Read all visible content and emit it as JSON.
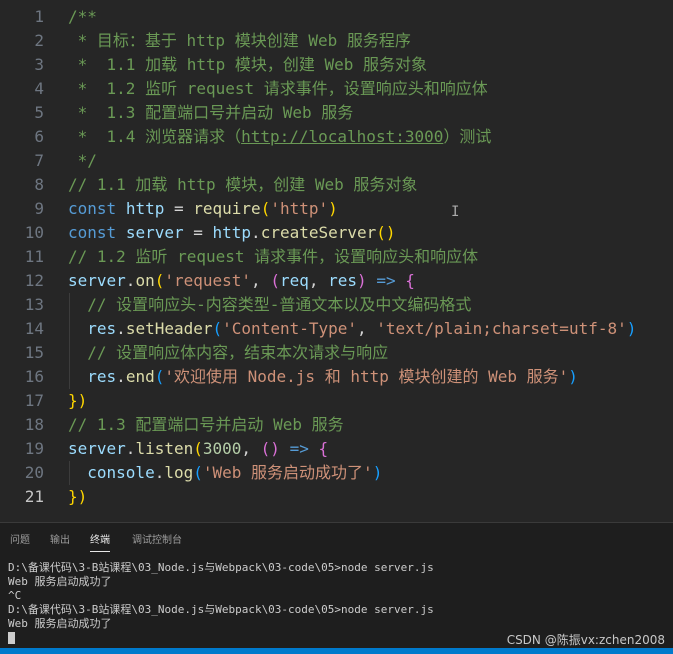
{
  "editor": {
    "lines": [
      {
        "n": "1",
        "tokens": [
          [
            "/**",
            "cm"
          ]
        ]
      },
      {
        "n": "2",
        "tokens": [
          [
            " * 目标：基于 http 模块创建 Web 服务程序",
            "cm"
          ]
        ]
      },
      {
        "n": "3",
        "tokens": [
          [
            " *  1.1 加载 http 模块，创建 Web 服务对象",
            "cm"
          ]
        ]
      },
      {
        "n": "4",
        "tokens": [
          [
            " *  1.2 监听 request 请求事件，设置响应头和响应体",
            "cm"
          ]
        ]
      },
      {
        "n": "5",
        "tokens": [
          [
            " *  1.3 配置端口号并启动 Web 服务",
            "cm"
          ]
        ]
      },
      {
        "n": "6",
        "tokens": [
          [
            " *  1.4 浏览器请求（",
            "cm"
          ],
          [
            "http://localhost:3000",
            "link"
          ],
          [
            "）测试",
            "cm"
          ]
        ]
      },
      {
        "n": "7",
        "tokens": [
          [
            " */",
            "cm"
          ]
        ]
      },
      {
        "n": "8",
        "tokens": [
          [
            "// 1.1 加载 http 模块，创建 Web 服务对象",
            "cm"
          ]
        ]
      },
      {
        "n": "9",
        "tokens": [
          [
            "const",
            "kw"
          ],
          [
            " ",
            "pun"
          ],
          [
            "http",
            "var"
          ],
          [
            " = ",
            "pun"
          ],
          [
            "require",
            "fn"
          ],
          [
            "(",
            "br1"
          ],
          [
            "'http'",
            "str"
          ],
          [
            ")",
            "br1"
          ]
        ]
      },
      {
        "n": "10",
        "tokens": [
          [
            "const",
            "kw"
          ],
          [
            " ",
            "pun"
          ],
          [
            "server",
            "var"
          ],
          [
            " = ",
            "pun"
          ],
          [
            "http",
            "var"
          ],
          [
            ".",
            "pun"
          ],
          [
            "createServer",
            "fn"
          ],
          [
            "()",
            "br1"
          ]
        ]
      },
      {
        "n": "11",
        "tokens": [
          [
            "// 1.2 监听 request 请求事件，设置响应头和响应体",
            "cm"
          ]
        ]
      },
      {
        "n": "12",
        "tokens": [
          [
            "server",
            "var"
          ],
          [
            ".",
            "pun"
          ],
          [
            "on",
            "fn"
          ],
          [
            "(",
            "br1"
          ],
          [
            "'request'",
            "str"
          ],
          [
            ", ",
            "pun"
          ],
          [
            "(",
            "br2"
          ],
          [
            "req",
            "var"
          ],
          [
            ", ",
            "pun"
          ],
          [
            "res",
            "var"
          ],
          [
            ")",
            "br2"
          ],
          [
            " ",
            "pun"
          ],
          [
            "=>",
            "kw"
          ],
          [
            " ",
            "pun"
          ],
          [
            "{",
            "br2"
          ]
        ]
      },
      {
        "n": "13",
        "tokens": [
          [
            "  // 设置响应头-内容类型-普通文本以及中文编码格式",
            "cm"
          ]
        ]
      },
      {
        "n": "14",
        "tokens": [
          [
            "  ",
            "pun"
          ],
          [
            "res",
            "var"
          ],
          [
            ".",
            "pun"
          ],
          [
            "setHeader",
            "fn"
          ],
          [
            "(",
            "br3"
          ],
          [
            "'Content-Type'",
            "str"
          ],
          [
            ", ",
            "pun"
          ],
          [
            "'text/plain;charset=utf-8'",
            "str"
          ],
          [
            ")",
            "br3"
          ]
        ]
      },
      {
        "n": "15",
        "tokens": [
          [
            "  // 设置响应体内容，结束本次请求与响应",
            "cm"
          ]
        ]
      },
      {
        "n": "16",
        "tokens": [
          [
            "  ",
            "pun"
          ],
          [
            "res",
            "var"
          ],
          [
            ".",
            "pun"
          ],
          [
            "end",
            "fn"
          ],
          [
            "(",
            "br3"
          ],
          [
            "'欢迎使用 Node.js 和 http 模块创建的 Web 服务'",
            "str"
          ],
          [
            ")",
            "br3"
          ]
        ]
      },
      {
        "n": "17",
        "tokens": [
          [
            "})",
            "br1"
          ]
        ]
      },
      {
        "n": "18",
        "tokens": [
          [
            "// 1.3 配置端口号并启动 Web 服务",
            "cm"
          ]
        ]
      },
      {
        "n": "19",
        "tokens": [
          [
            "server",
            "var"
          ],
          [
            ".",
            "pun"
          ],
          [
            "listen",
            "fn"
          ],
          [
            "(",
            "br1"
          ],
          [
            "3000",
            "num"
          ],
          [
            ", ",
            "pun"
          ],
          [
            "()",
            "br2"
          ],
          [
            " ",
            "pun"
          ],
          [
            "=>",
            "kw"
          ],
          [
            " ",
            "pun"
          ],
          [
            "{",
            "br2"
          ]
        ]
      },
      {
        "n": "20",
        "tokens": [
          [
            "  ",
            "pun"
          ],
          [
            "console",
            "var"
          ],
          [
            ".",
            "pun"
          ],
          [
            "log",
            "fn"
          ],
          [
            "(",
            "br3"
          ],
          [
            "'Web 服务启动成功了'",
            "str"
          ],
          [
            ")",
            "br3"
          ]
        ]
      },
      {
        "n": "21",
        "tokens": [
          [
            "})",
            "br1"
          ]
        ]
      }
    ],
    "active_line": "21"
  },
  "panel": {
    "tabs": [
      "问题",
      "输出",
      "终端",
      "调试控制台"
    ],
    "active_tab": "终端",
    "terminal": [
      "D:\\备课代码\\3-B站课程\\03_Node.js与Webpack\\03-code\\05>node server.js",
      "Web 服务启动成功了",
      "^C",
      "D:\\备课代码\\3-B站课程\\03_Node.js与Webpack\\03-code\\05>node server.js",
      "Web 服务启动成功了"
    ]
  },
  "watermark": "CSDN @陈振vx:zchen2008",
  "colors": {
    "editor_bg": "#262626",
    "comment": "#6a9955",
    "keyword": "#569cd6",
    "string": "#ce9178",
    "function": "#dcdcaa",
    "variable": "#9cdcfe",
    "number": "#b5cea8",
    "statusbar": "#007acc"
  },
  "icons": {
    "text_cursor": "ibeam-icon"
  }
}
